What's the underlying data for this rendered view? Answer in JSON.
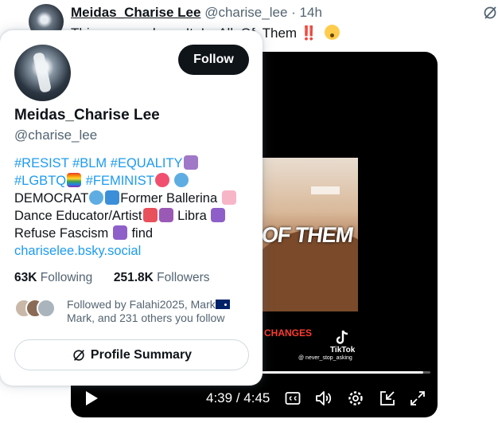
{
  "tweet": {
    "author_name": "Meidas_Charise Lee",
    "author_handle": "@charise_lee",
    "separator": "·",
    "time": "14h",
    "text": "This runs so deep. It. Is. All. Of. Them",
    "text_bangs": "‼️"
  },
  "video": {
    "overlay_text": "OF THEM",
    "caption_text": "CHANGES",
    "tiktok_label": "TikTok",
    "tiktok_handle": "@ never_stop_asking",
    "current_time": "4:39",
    "time_separator": "/",
    "duration": "4:45",
    "progress_fraction": 0.979,
    "icons": [
      "play-icon",
      "closed-captions-icon",
      "volume-icon",
      "settings-icon",
      "dock-icon",
      "fullscreen-icon"
    ]
  },
  "hovercard": {
    "name": "Meidas_Charise Lee",
    "handle": "@charise_lee",
    "follow_label": "Follow",
    "bio": {
      "l1_tags": [
        "#RESIST",
        "#BLM",
        "#EQUALITY"
      ],
      "l2_tags": [
        "#LGBTQ",
        "#FEMINIST"
      ],
      "l3": "DEMOCRAT",
      "l3b": "Former Ballerina",
      "l4": "Dance Educator/Artist",
      "l4b": "Libra",
      "l5": "Refuse Fascism",
      "l5b": "find",
      "link": "chariselee.bsky.social"
    },
    "following_count": "63K",
    "following_label": "Following",
    "followers_count": "251.8K",
    "followers_label": "Followers",
    "followed_by_text": "Followed by Falahi2025, Mark",
    "followed_by_text2": "Mark, and 231 others you follow",
    "summary_label": "Profile Summary"
  },
  "colors": {
    "accent": "#1d9bf0",
    "text": "#0f1419",
    "muted": "#536471",
    "border": "#cfd9de"
  }
}
